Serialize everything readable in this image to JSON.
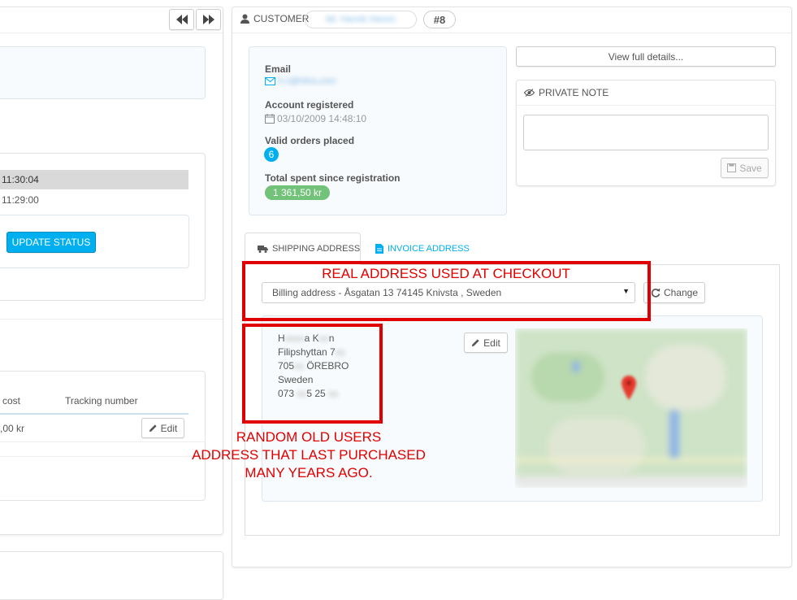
{
  "left": {
    "nav": {
      "prev": "◀◀",
      "next": "▶▶"
    },
    "history": [
      {
        "time": "11:30:04"
      },
      {
        "time": "11:29:00"
      }
    ],
    "update_status": "UPDATE STATUS",
    "shipping_table": {
      "col_cost": "cost",
      "col_tracking": "Tracking number",
      "row_cost": ",00 kr",
      "edit": "Edit"
    }
  },
  "customer": {
    "heading": "CUSTOMER",
    "name": "Mr. Henrik Hemm",
    "number": "#8",
    "email_label": "Email",
    "email_value": "h.n@hitra.com",
    "registered_label": "Account registered",
    "registered_value": "03/10/2009 14:48:10",
    "orders_label": "Valid orders placed",
    "orders_value": "6",
    "spent_label": "Total spent since registration",
    "spent_value": "1 361,50 kr",
    "view_details": "View full details...",
    "private_note_title": "PRIVATE NOTE",
    "save": "Save"
  },
  "tabs": {
    "shipping": "SHIPPING ADDRESS",
    "invoice": "INVOICE ADDRESS"
  },
  "address_select": "Billing address - Åsgatan 13 74145 Knivsta , Sweden",
  "change_button": "Change",
  "address": {
    "name_first": "H",
    "name_mid": "a K",
    "name_end": "n",
    "street": "Filipshyttan 7",
    "postal_prefix": "705",
    "city": "ÖREBRO",
    "country": "Sweden",
    "phone_a": "073",
    "phone_b": "5 25",
    "edit": "Edit"
  },
  "annotations": {
    "real": "REAL ADDRESS USED AT CHECKOUT",
    "random_line1": "RANDOM OLD USERS",
    "random_line2": "ADDRESS THAT LAST PURCHASED",
    "random_line3": "MANY YEARS AGO."
  },
  "colors": {
    "accent": "#00aff0",
    "annotation": "#e00000",
    "success": "#72c279"
  }
}
